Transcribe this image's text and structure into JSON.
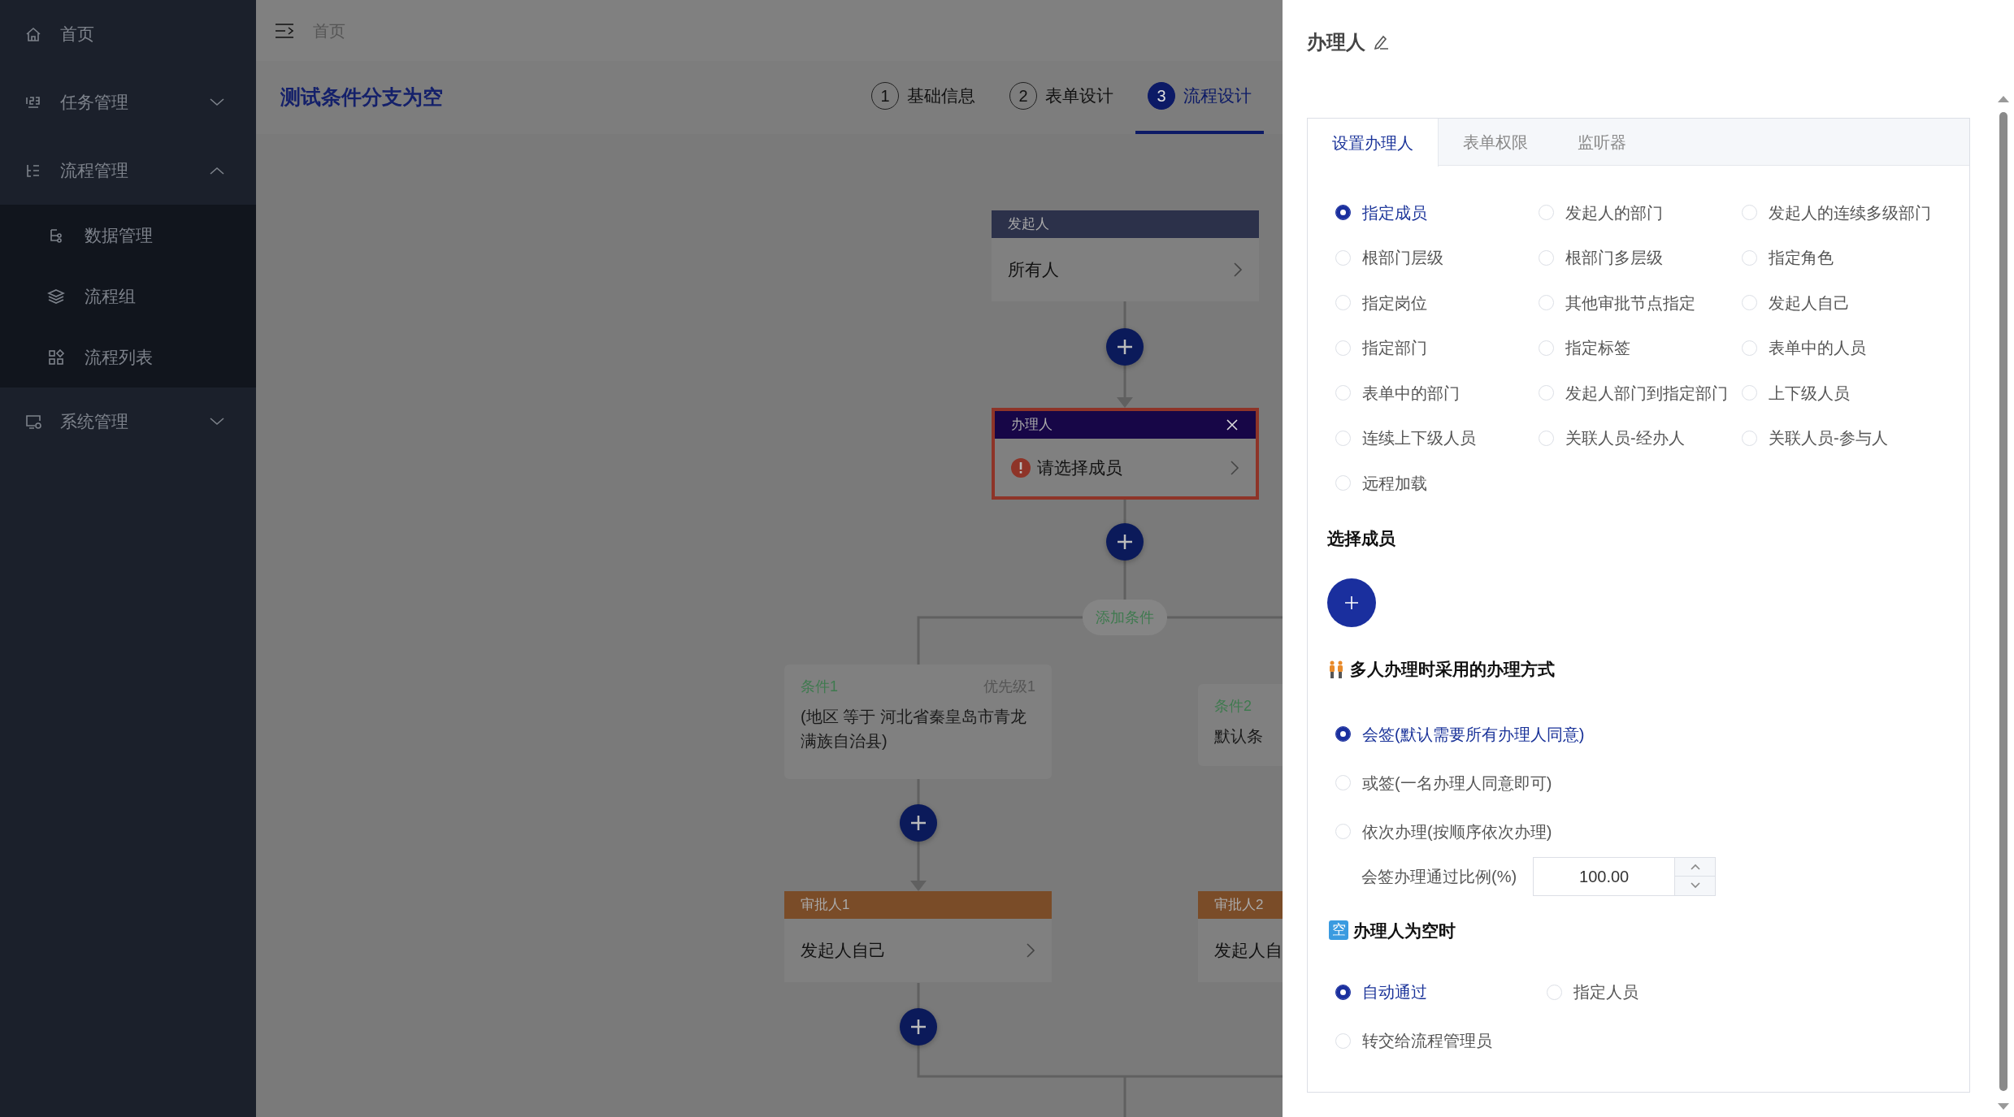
{
  "sidebar": {
    "items": [
      {
        "label": "首页",
        "kind": "link"
      },
      {
        "label": "任务管理",
        "kind": "group",
        "expanded": false
      },
      {
        "label": "流程管理",
        "kind": "group",
        "expanded": true,
        "children": [
          {
            "label": "数据管理"
          },
          {
            "label": "流程组"
          },
          {
            "label": "流程列表"
          }
        ]
      },
      {
        "label": "系统管理",
        "kind": "group",
        "expanded": false
      }
    ]
  },
  "topbar": {
    "breadcrumb": "首页"
  },
  "header": {
    "title": "测试条件分支为空",
    "steps": [
      {
        "number": "1",
        "label": "基础信息",
        "selected": false
      },
      {
        "number": "2",
        "label": "表单设计",
        "selected": false
      },
      {
        "number": "3",
        "label": "流程设计",
        "selected": true
      }
    ]
  },
  "flow": {
    "start": {
      "kind": "start",
      "title": "发起人",
      "content": "所有人",
      "error": false,
      "selected": false,
      "show_arrow": true
    },
    "handler": {
      "kind": "handler",
      "title": "办理人",
      "content": "请选择成员",
      "error": true,
      "selected": true,
      "show_arrow": true
    },
    "add_condition": "添加条件",
    "branches": [
      {
        "condition": {
          "title": "条件1",
          "priority": "优先级1",
          "text": "(地区 等于 河北省秦皇岛市青龙满族自治县)"
        },
        "approver": {
          "kind": "approver",
          "title": "审批人1",
          "content": "发起人自己",
          "error": false,
          "selected": false,
          "show_arrow": true
        }
      },
      {
        "condition": {
          "title": "条件2",
          "text": "默认条"
        },
        "approver": {
          "kind": "approver",
          "title": "审批人2",
          "content": "发起人自",
          "error": false
        }
      }
    ]
  },
  "drawer": {
    "title": "办理人",
    "tabs": [
      {
        "label": "设置办理人",
        "selected": true
      },
      {
        "label": "表单权限",
        "selected": false
      },
      {
        "label": "监听器",
        "selected": false
      }
    ],
    "assignee_types": [
      {
        "label": "指定成员",
        "selected": true
      },
      {
        "label": "发起人的部门",
        "selected": false
      },
      {
        "label": "发起人的连续多级部门",
        "selected": false
      },
      {
        "label": "根部门层级",
        "selected": false
      },
      {
        "label": "根部门多层级",
        "selected": false
      },
      {
        "label": "指定角色",
        "selected": false
      },
      {
        "label": "指定岗位",
        "selected": false
      },
      {
        "label": "其他审批节点指定",
        "selected": false
      },
      {
        "label": "发起人自己",
        "selected": false
      },
      {
        "label": "指定部门",
        "selected": false
      },
      {
        "label": "指定标签",
        "selected": false
      },
      {
        "label": "表单中的人员",
        "selected": false
      },
      {
        "label": "表单中的部门",
        "selected": false
      },
      {
        "label": "发起人部门到指定部门",
        "selected": false
      },
      {
        "label": "上下级人员",
        "selected": false
      },
      {
        "label": "连续上下级人员",
        "selected": false
      },
      {
        "label": "关联人员-经办人",
        "selected": false
      },
      {
        "label": "关联人员-参与人",
        "selected": false
      },
      {
        "label": "远程加载",
        "selected": false
      }
    ],
    "select_members": {
      "title": "选择成员"
    },
    "multi_mode": {
      "title": "多人办理时采用的办理方式",
      "options": [
        {
          "label": "会签(默认需要所有办理人同意)",
          "selected": true
        },
        {
          "label": "或签(一名办理人同意即可)",
          "selected": false
        },
        {
          "label": "依次办理(按顺序依次办理)",
          "selected": false
        }
      ],
      "ratio": {
        "label": "会签办理通过比例(%)",
        "value": "100.00"
      }
    },
    "empty_mode": {
      "title": "办理人为空时",
      "badge": "空",
      "options": [
        {
          "label": "自动通过",
          "selected": true
        },
        {
          "label": "指定人员",
          "selected": false
        },
        {
          "label": "转交给流程管理员",
          "selected": false
        }
      ]
    }
  }
}
